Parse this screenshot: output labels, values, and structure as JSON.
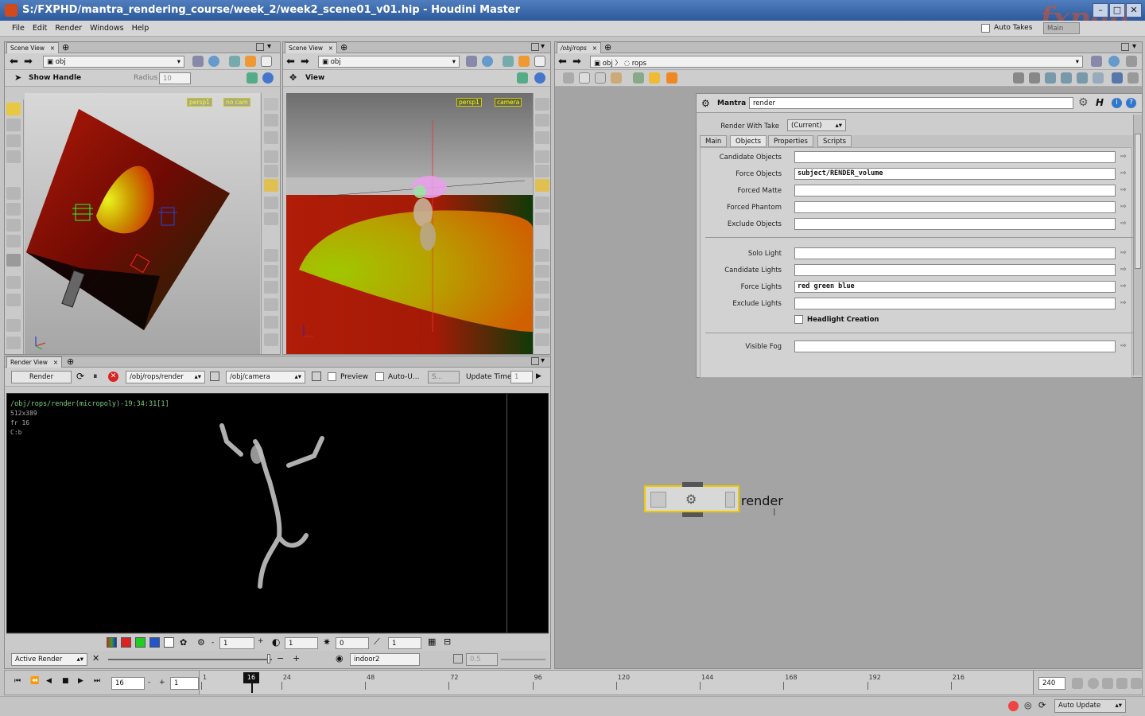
{
  "window": {
    "title": "S:/FXPHD/mantra_rendering_course/week_2/week2_scene01_v01.hip - Houdini Master",
    "logo": "fxphd"
  },
  "menu": {
    "items": [
      "File",
      "Edit",
      "Render",
      "Windows",
      "Help"
    ],
    "auto_takes": "Auto Takes",
    "take": "Main"
  },
  "left_view": {
    "tab": "Scene View",
    "path": "obj",
    "show_handle": "Show Handle",
    "radius_label": "Radius",
    "radius_value": "10",
    "camera_badge": "persp1",
    "cam_badge": "no cam"
  },
  "mid_view": {
    "tab": "Scene View",
    "path": "obj",
    "view_label": "View",
    "camera_badge": "persp1",
    "cam_badge": "camera"
  },
  "render_view": {
    "tab": "Render View",
    "render_button": "Render",
    "rop_path": "/obj/rops/render",
    "camera_path": "/obj/camera",
    "preview": "Preview",
    "auto_update": "Auto-U...",
    "s_field": "S...",
    "update_time": "Update Time",
    "update_time_value": "1",
    "info_line1": "/obj/rops/render(micropoly)-19:34:31[1]",
    "info_line2": "512x389",
    "info_line3": "fr 16",
    "info_line4": "C:b",
    "frame_field": "1",
    "exposure_field": "1",
    "gamma_field": "0",
    "lut_field": "1",
    "active_render": "Active Render",
    "snapshot_name": "indoor2",
    "opacity_value": "0.5"
  },
  "network": {
    "tab": "/obj/rops",
    "path_obj": "obj",
    "path_rops": "rops",
    "node_label": "render"
  },
  "params": {
    "node_type": "Mantra",
    "node_name": "render",
    "render_with_take_label": "Render With Take",
    "render_with_take_value": "(Current)",
    "tabs": [
      "Main",
      "Objects",
      "Properties",
      "Scripts"
    ],
    "active_tab": "Objects",
    "object_fields": [
      {
        "label": "Candidate Objects",
        "value": ""
      },
      {
        "label": "Force Objects",
        "value": "subject/RENDER_volume"
      },
      {
        "label": "Forced Matte",
        "value": ""
      },
      {
        "label": "Forced Phantom",
        "value": ""
      },
      {
        "label": "Exclude Objects",
        "value": ""
      }
    ],
    "light_fields": [
      {
        "label": "Solo Light",
        "value": ""
      },
      {
        "label": "Candidate Lights",
        "value": ""
      },
      {
        "label": "Force Lights",
        "value": "red green blue"
      },
      {
        "label": "Exclude Lights",
        "value": ""
      }
    ],
    "headlight_label": "Headlight Creation",
    "visible_fog_label": "Visible Fog",
    "visible_fog_value": ""
  },
  "timeline": {
    "current_frame": "16",
    "step": "1",
    "marker": "16",
    "end_frame": "240",
    "ticks": [
      "1",
      "24",
      "48",
      "72",
      "96",
      "120",
      "144",
      "168",
      "192",
      "216"
    ],
    "auto_update": "Auto Update"
  },
  "colors": {
    "title_blue": "#2d5a9c",
    "viewport_floor_red": "#b01d08",
    "light_cone_yellow": "#c8c800",
    "node_highlight": "#f0c800",
    "render_green_text": "#7fd07f"
  }
}
